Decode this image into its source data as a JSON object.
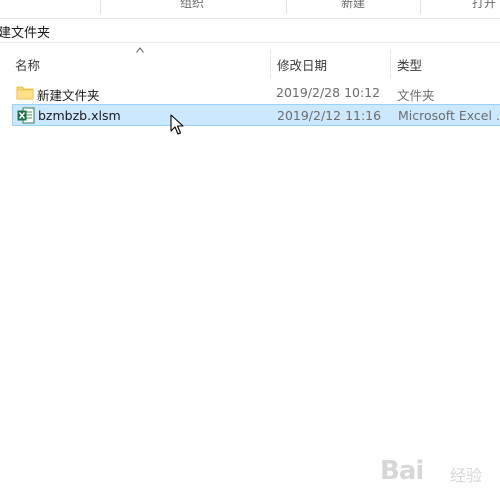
{
  "ribbon": {
    "groups": [
      {
        "label": "组织"
      },
      {
        "label": "新建"
      },
      {
        "label": "打开"
      }
    ]
  },
  "address": {
    "crumb": "建文件夹"
  },
  "columns": {
    "name": "名称",
    "date": "修改日期",
    "type": "类型"
  },
  "files": [
    {
      "name": "新建文件夹",
      "date": "2019/2/28 10:12",
      "type": "文件夹",
      "icon": "folder-icon",
      "selected": false
    },
    {
      "name": "bzmbzb.xlsm",
      "date": "2019/2/12 11:16",
      "type": "Microsoft Excel ...",
      "icon": "excel-file-icon",
      "selected": true
    }
  ],
  "watermark": {
    "text": "Bai",
    "sub": "经验"
  },
  "colors": {
    "selection_bg": "#cce8ff",
    "selection_border": "#99d1ff",
    "folder": "#f8d775",
    "excel": "#1d7044"
  }
}
